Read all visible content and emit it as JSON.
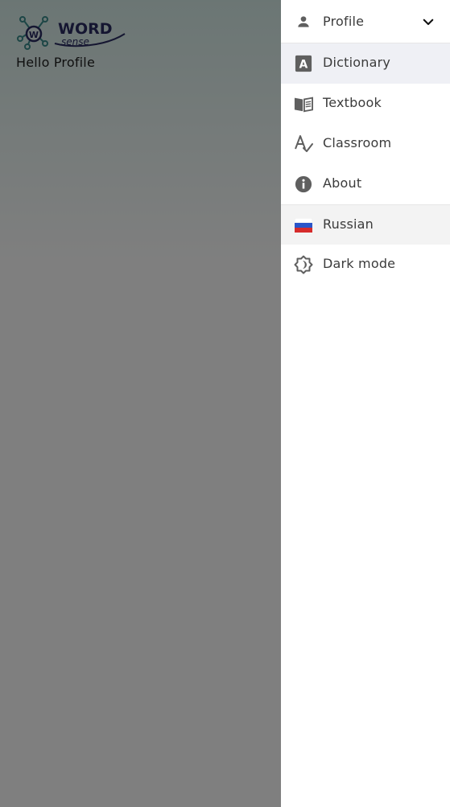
{
  "app": {
    "logo_text": "WORD",
    "logo_subtext": "sense",
    "greeting": "Hello Profile"
  },
  "drawer": {
    "profile_label": "Profile",
    "items": [
      {
        "label": "Dictionary",
        "icon": "dictionary-icon",
        "active": true
      },
      {
        "label": "Textbook",
        "icon": "textbook-icon"
      },
      {
        "label": "Classroom",
        "icon": "classroom-icon"
      },
      {
        "label": "About",
        "icon": "info-icon"
      }
    ],
    "language_label": "Russian",
    "language_icon": "russian-flag-icon",
    "dark_mode_label": "Dark mode",
    "dark_mode_icon": "dark-mode-icon"
  },
  "colors": {
    "overlay": "#808080",
    "drawer_bg": "#ffffff",
    "active_bg": "#eff0f5",
    "icon": "#5f5f5f",
    "logo_navy": "#2b2d63",
    "logo_teal": "#3b8c8c"
  }
}
